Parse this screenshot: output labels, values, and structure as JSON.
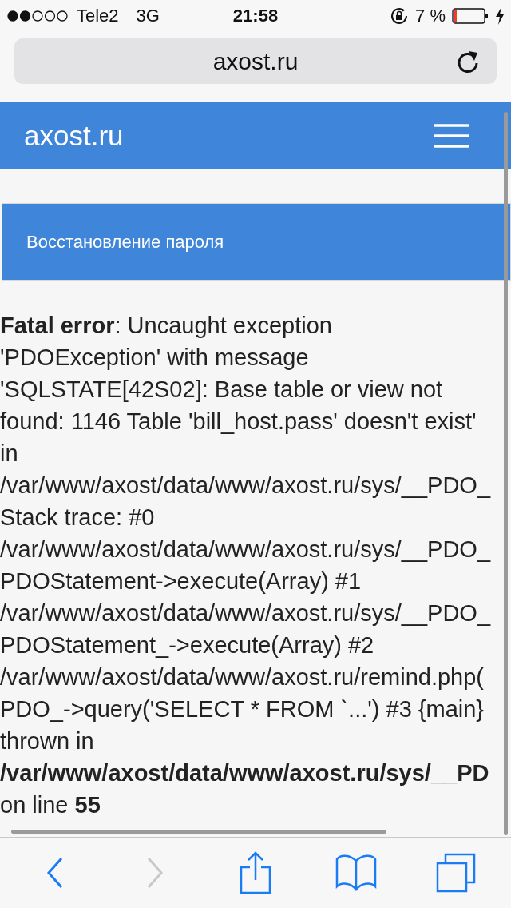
{
  "status_bar": {
    "carrier": "Tele2",
    "network": "3G",
    "time": "21:58",
    "battery_percent": "7 %"
  },
  "address_bar": {
    "url": "axost.ru"
  },
  "site_header": {
    "title": "axost.ru"
  },
  "panel": {
    "title": "Восстановление пароля"
  },
  "error_lines": [
    {
      "text": "**Fatal error**: Uncaught exception",
      "bold": false
    },
    {
      "text": "'PDOException' with message",
      "bold": false
    },
    {
      "text": "'SQLSTATE[42S02]: Base table or view not",
      "bold": false
    },
    {
      "text": "found: 1146 Table 'bill_host.pass' doesn't exist'",
      "bold": false
    },
    {
      "text": "in",
      "bold": false
    },
    {
      "text": "/var/www/axost/data/www/axost.ru/sys/__PDO_",
      "bold": false
    },
    {
      "text": "Stack trace: #0",
      "bold": false
    },
    {
      "text": "/var/www/axost/data/www/axost.ru/sys/__PDO_",
      "bold": false
    },
    {
      "text": "PDOStatement->execute(Array) #1",
      "bold": false
    },
    {
      "text": "/var/www/axost/data/www/axost.ru/sys/__PDO_",
      "bold": false
    },
    {
      "text": "PDOStatement_->execute(Array) #2",
      "bold": false
    },
    {
      "text": "/var/www/axost/data/www/axost.ru/remind.php(",
      "bold": false
    },
    {
      "text": "PDO_->query('SELECT * FROM `...') #3 {main}",
      "bold": false
    },
    {
      "text": "thrown in",
      "bold": false
    },
    {
      "text": "/var/www/axost/data/www/axost.ru/sys/__PD",
      "bold": true
    },
    {
      "text": "on line **55**",
      "bold": false
    }
  ],
  "toolbar": [
    {
      "kind": "back",
      "disabled": false
    },
    {
      "kind": "forward",
      "disabled": true
    },
    {
      "kind": "share",
      "disabled": false
    },
    {
      "kind": "bookmarks",
      "disabled": false
    },
    {
      "kind": "tabs",
      "disabled": false
    }
  ]
}
